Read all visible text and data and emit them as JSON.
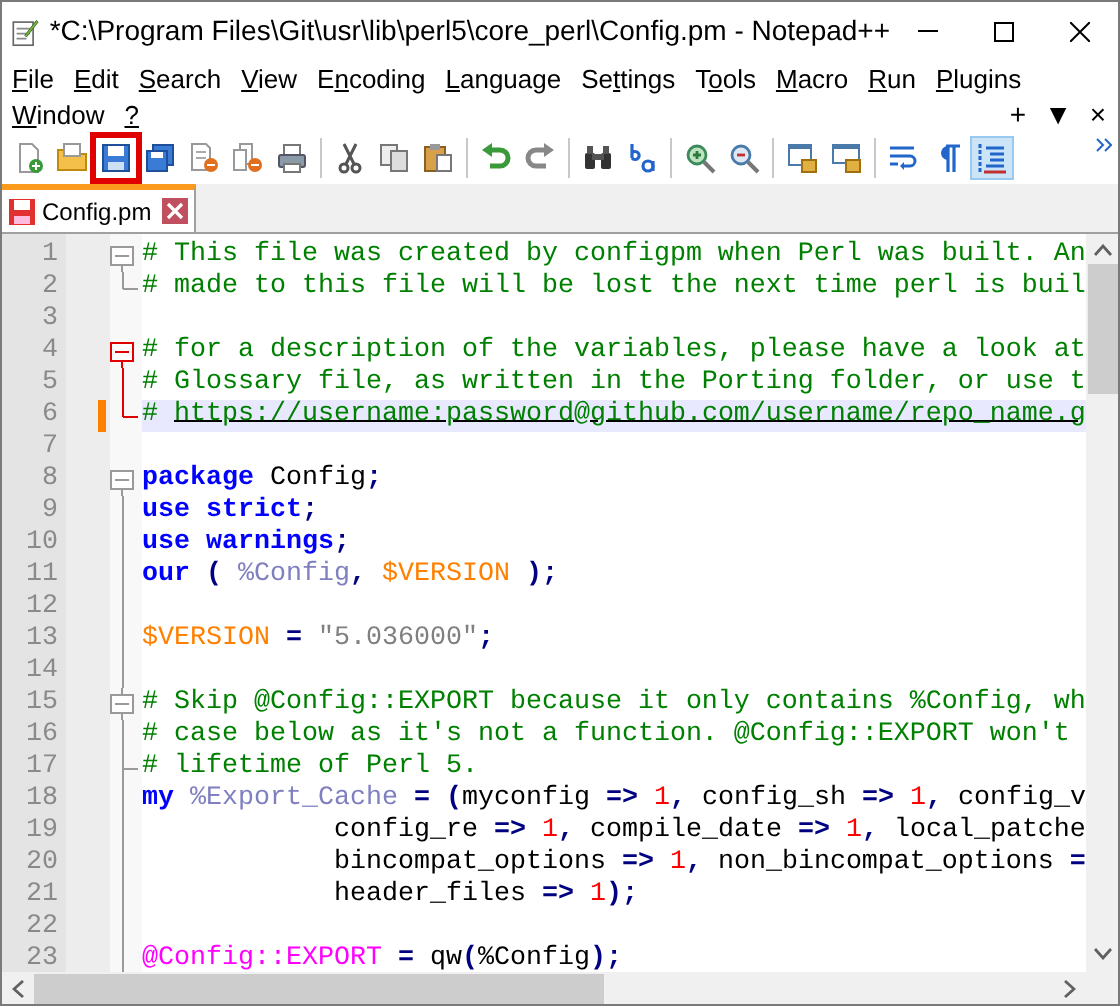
{
  "window": {
    "title": "*C:\\Program Files\\Git\\usr\\lib\\perl5\\core_perl\\Config.pm - Notepad++"
  },
  "menu": [
    {
      "key": "F",
      "post": "ile"
    },
    {
      "key": "E",
      "post": "dit"
    },
    {
      "key": "S",
      "post": "earch"
    },
    {
      "key": "V",
      "post": "iew"
    },
    {
      "pre": "E",
      "key": "n",
      "post": "coding"
    },
    {
      "key": "L",
      "post": "anguage"
    },
    {
      "pre": "Se",
      "key": "t",
      "post": "tings"
    },
    {
      "pre": "T",
      "key": "o",
      "post": "ols"
    },
    {
      "key": "M",
      "post": "acro"
    },
    {
      "key": "R",
      "post": "un"
    },
    {
      "key": "P",
      "post": "lugins"
    },
    {
      "key": "W",
      "post": "indow"
    },
    {
      "key": "?"
    }
  ],
  "menu_right": [
    "+",
    "▼",
    "×"
  ],
  "toolbar": [
    {
      "kind": "new"
    },
    {
      "kind": "open"
    },
    {
      "kind": "save",
      "highlighted": true
    },
    {
      "kind": "saveall"
    },
    {
      "kind": "close"
    },
    {
      "kind": "closeall"
    },
    {
      "kind": "print"
    },
    {
      "kind": "sep"
    },
    {
      "kind": "cut"
    },
    {
      "kind": "copy"
    },
    {
      "kind": "paste"
    },
    {
      "kind": "sep"
    },
    {
      "kind": "undo"
    },
    {
      "kind": "redo"
    },
    {
      "kind": "sep"
    },
    {
      "kind": "find"
    },
    {
      "kind": "replace"
    },
    {
      "kind": "sep"
    },
    {
      "kind": "zoomin"
    },
    {
      "kind": "zoomout"
    },
    {
      "kind": "sep"
    },
    {
      "kind": "syncv"
    },
    {
      "kind": "synch"
    },
    {
      "kind": "sep"
    },
    {
      "kind": "wrap"
    },
    {
      "kind": "pilcrow"
    },
    {
      "kind": "indentguide",
      "checked": true
    }
  ],
  "tabs": [
    {
      "label": "Config.pm",
      "selected": true,
      "modified": true
    }
  ],
  "editor": {
    "lines": [
      {
        "number": "1",
        "fold_start": true,
        "fold_active": false,
        "current": false,
        "changed": false,
        "tokens": [
          {
            "kind": "comment",
            "text": "# This file was created by configpm when Perl was built. An"
          }
        ]
      },
      {
        "number": "2",
        "fold_end": true,
        "fold_active": false,
        "current": false,
        "changed": false,
        "tokens": [
          {
            "kind": "comment",
            "text": "# made to this file will be lost the next time perl is buil"
          }
        ]
      },
      {
        "number": "3",
        "current": false,
        "changed": false
      },
      {
        "number": "4",
        "fold_start": true,
        "fold_active": true,
        "current": false,
        "changed": false,
        "tokens": [
          {
            "kind": "comment",
            "text": "# for a description of the variables, please have a look at"
          }
        ]
      },
      {
        "number": "5",
        "in_fold": true,
        "fold_active": true,
        "current": false,
        "changed": false,
        "tokens": [
          {
            "kind": "comment",
            "text": "# Glossary file, as written in the Porting folder, or use t"
          }
        ]
      },
      {
        "number": "6",
        "fold_end": true,
        "fold_active": true,
        "current": true,
        "changed": true,
        "tokens": [
          {
            "kind": "comment",
            "text": "# "
          },
          {
            "kind": "url",
            "text": "https://username:password@github.com/username/repo_name.g"
          }
        ]
      },
      {
        "number": "7",
        "current": false,
        "changed": false
      },
      {
        "number": "8",
        "fold_start": true,
        "fold_active": false,
        "current": false,
        "changed": false,
        "tokens": [
          {
            "kind": "keyword",
            "text": "package"
          },
          {
            "kind": "plain",
            "text": " Config"
          },
          {
            "kind": "operator",
            "text": ";"
          }
        ]
      },
      {
        "number": "9",
        "in_fold": true,
        "fold_active": false,
        "current": false,
        "changed": false,
        "tokens": [
          {
            "kind": "keyword",
            "text": "use strict"
          },
          {
            "kind": "operator",
            "text": ";"
          }
        ]
      },
      {
        "number": "10",
        "in_fold": true,
        "fold_active": false,
        "current": false,
        "changed": false,
        "tokens": [
          {
            "kind": "keyword",
            "text": "use warnings"
          },
          {
            "kind": "operator",
            "text": ";"
          }
        ]
      },
      {
        "number": "11",
        "in_fold": true,
        "fold_active": false,
        "current": false,
        "changed": false,
        "tokens": [
          {
            "kind": "keyword",
            "text": "our "
          },
          {
            "kind": "operator",
            "text": "( "
          },
          {
            "kind": "hash",
            "text": "%Config"
          },
          {
            "kind": "operator",
            "text": ", "
          },
          {
            "kind": "scalar",
            "text": "$VERSION "
          },
          {
            "kind": "operator",
            "text": ");"
          }
        ]
      },
      {
        "number": "12",
        "in_fold": true,
        "fold_active": false,
        "current": false,
        "changed": false
      },
      {
        "number": "13",
        "in_fold": true,
        "fold_active": false,
        "current": false,
        "changed": false,
        "tokens": [
          {
            "kind": "scalar",
            "text": "$VERSION "
          },
          {
            "kind": "operator",
            "text": "= "
          },
          {
            "kind": "string",
            "text": "\"5.036000\""
          },
          {
            "kind": "operator",
            "text": ";"
          }
        ]
      },
      {
        "number": "14",
        "in_fold": true,
        "fold_active": false,
        "current": false,
        "changed": false
      },
      {
        "number": "15",
        "fold_start": true,
        "in_fold": true,
        "fold_active": false,
        "current": false,
        "changed": false,
        "tokens": [
          {
            "kind": "comment",
            "text": "# Skip @Config::EXPORT because it only contains %Config, wh"
          }
        ]
      },
      {
        "number": "16",
        "in_fold": true,
        "fold_active": false,
        "current": false,
        "changed": false,
        "tokens": [
          {
            "kind": "comment",
            "text": "# case below as it's not a function. @Config::EXPORT won't"
          }
        ]
      },
      {
        "number": "17",
        "fold_end": true,
        "in_fold": true,
        "fold_active": false,
        "current": false,
        "changed": false,
        "tokens": [
          {
            "kind": "comment",
            "text": "# lifetime of Perl 5."
          }
        ]
      },
      {
        "number": "18",
        "in_fold": true,
        "fold_active": false,
        "current": false,
        "changed": false,
        "tokens": [
          {
            "kind": "keyword",
            "text": "my "
          },
          {
            "kind": "hash",
            "text": "%Export_Cache "
          },
          {
            "kind": "operator",
            "text": "= ("
          },
          {
            "kind": "plain",
            "text": "myconfig "
          },
          {
            "kind": "operator",
            "text": "=> "
          },
          {
            "kind": "number",
            "text": "1"
          },
          {
            "kind": "operator",
            "text": ", "
          },
          {
            "kind": "plain",
            "text": "config_sh "
          },
          {
            "kind": "operator",
            "text": "=> "
          },
          {
            "kind": "number",
            "text": "1"
          },
          {
            "kind": "operator",
            "text": ", "
          },
          {
            "kind": "plain",
            "text": "config_v"
          }
        ]
      },
      {
        "number": "19",
        "in_fold": true,
        "fold_active": false,
        "current": false,
        "changed": false,
        "tokens": [
          {
            "kind": "plain",
            "text": "            config_re "
          },
          {
            "kind": "operator",
            "text": "=> "
          },
          {
            "kind": "number",
            "text": "1"
          },
          {
            "kind": "operator",
            "text": ", "
          },
          {
            "kind": "plain",
            "text": "compile_date "
          },
          {
            "kind": "operator",
            "text": "=> "
          },
          {
            "kind": "number",
            "text": "1"
          },
          {
            "kind": "operator",
            "text": ", "
          },
          {
            "kind": "plain",
            "text": "local_patche"
          }
        ]
      },
      {
        "number": "20",
        "in_fold": true,
        "fold_active": false,
        "current": false,
        "changed": false,
        "tokens": [
          {
            "kind": "plain",
            "text": "            bincompat_options "
          },
          {
            "kind": "operator",
            "text": "=> "
          },
          {
            "kind": "number",
            "text": "1"
          },
          {
            "kind": "operator",
            "text": ", "
          },
          {
            "kind": "plain",
            "text": "non_bincompat_options "
          },
          {
            "kind": "operator",
            "text": "="
          }
        ]
      },
      {
        "number": "21",
        "in_fold": true,
        "fold_active": false,
        "current": false,
        "changed": false,
        "tokens": [
          {
            "kind": "plain",
            "text": "            header_files "
          },
          {
            "kind": "operator",
            "text": "=> "
          },
          {
            "kind": "number",
            "text": "1"
          },
          {
            "kind": "operator",
            "text": ");"
          }
        ]
      },
      {
        "number": "22",
        "in_fold": true,
        "fold_active": false,
        "current": false,
        "changed": false
      },
      {
        "number": "23",
        "in_fold": true,
        "fold_active": false,
        "current": false,
        "changed": false,
        "tokens": [
          {
            "kind": "array",
            "text": "@Config::EXPORT "
          },
          {
            "kind": "operator",
            "text": "= "
          },
          {
            "kind": "plain",
            "text": "qw"
          },
          {
            "kind": "operator",
            "text": "("
          },
          {
            "kind": "plain",
            "text": "%Config"
          },
          {
            "kind": "operator",
            "text": ");"
          }
        ]
      }
    ]
  }
}
